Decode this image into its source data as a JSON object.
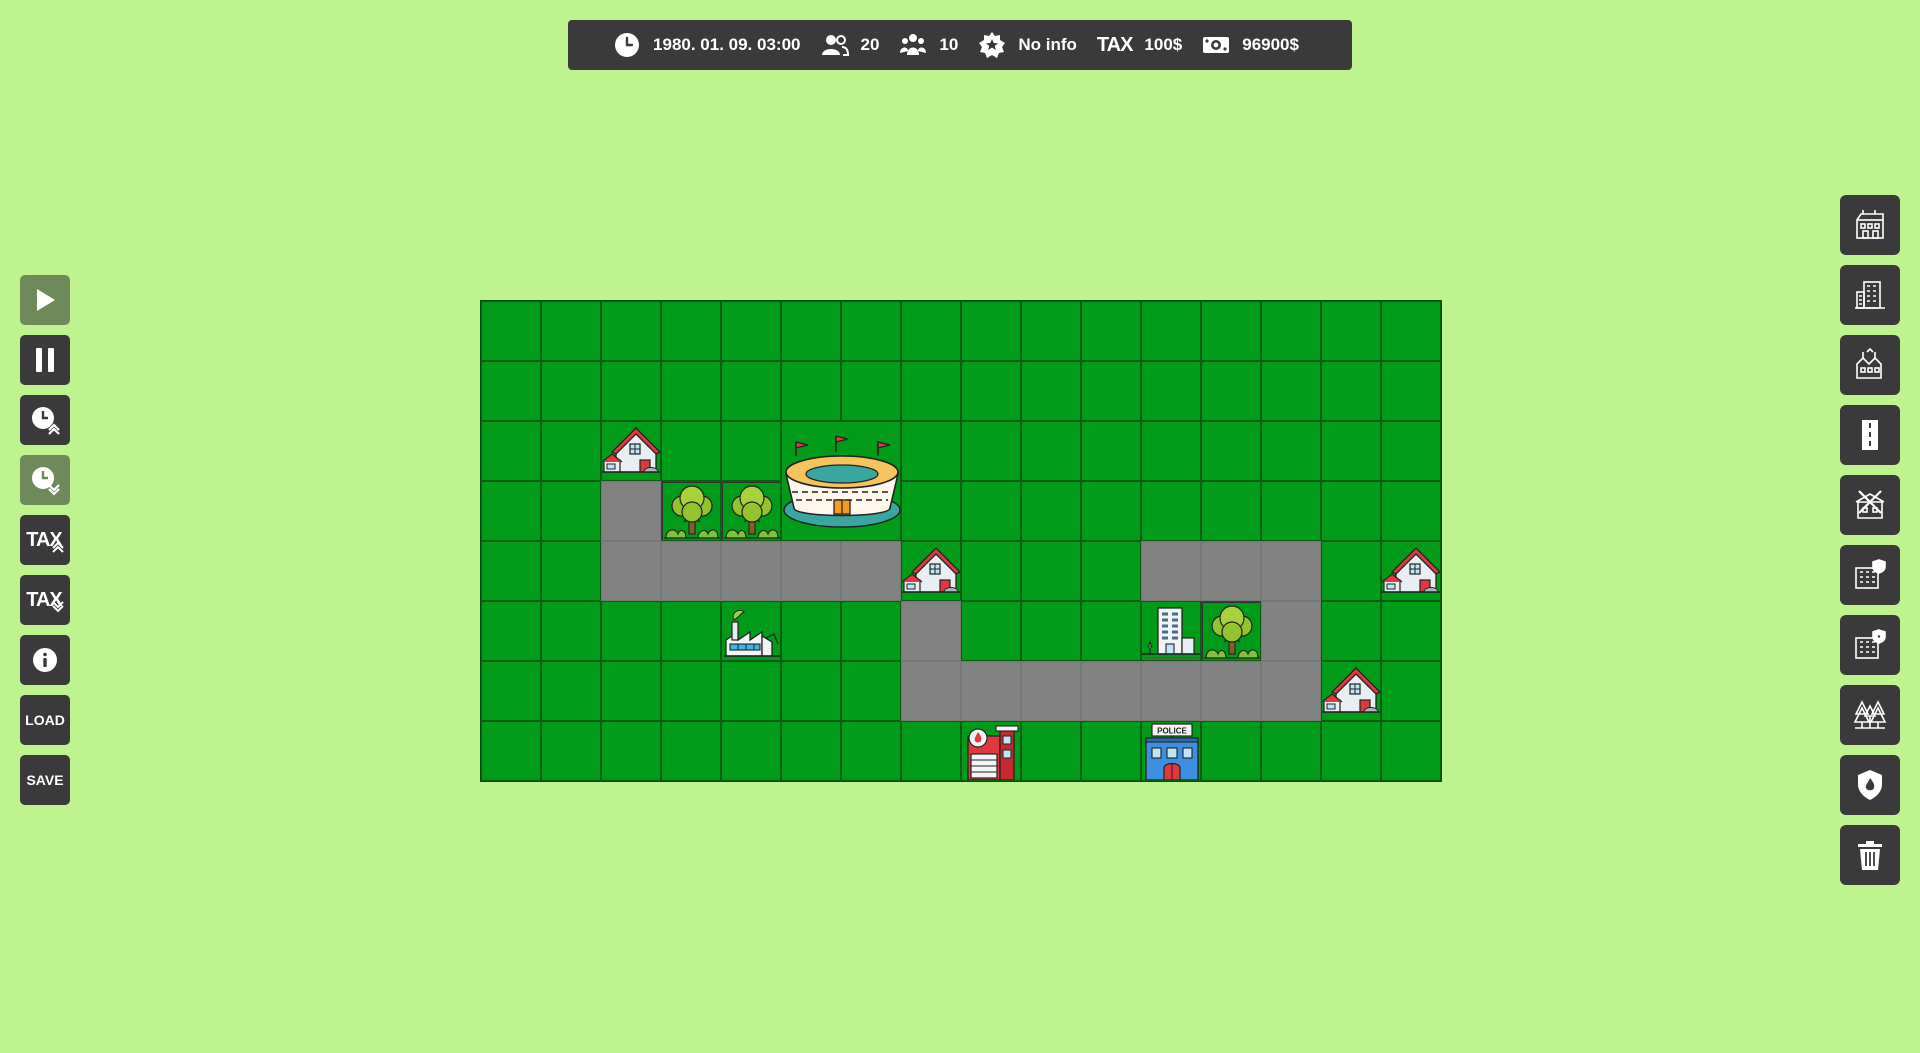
{
  "status_bar": {
    "date_time": "1980. 01. 09. 03:00",
    "population": "20",
    "workers": "10",
    "satisfaction": "No info",
    "tax_label": "TAX",
    "tax_value": "100$",
    "money": "96900$",
    "icons": [
      "clock-icon",
      "people-icon",
      "workers-icon",
      "star-badge-icon",
      "tax-icon",
      "money-icon"
    ]
  },
  "left_controls": {
    "play": {
      "icon": "play-icon",
      "state": "inactive"
    },
    "pause": {
      "icon": "pause-icon",
      "state": "active"
    },
    "speed_up": {
      "icon": "clock-speed-up-icon"
    },
    "speed_down": {
      "icon": "clock-speed-down-icon",
      "state": "inactive"
    },
    "tax_up_label": "TAX",
    "tax_down_label": "TAX",
    "info": {
      "icon": "info-icon"
    },
    "load_label": "LOAD",
    "save_label": "SAVE"
  },
  "right_toolbar": {
    "tools": [
      "residential-zone-icon",
      "office-building-icon",
      "industrial-zone-icon",
      "road-icon",
      "demolish-zone-icon",
      "police-station-icon",
      "fire-station-icon",
      "forest-icon",
      "fire-safety-icon",
      "trash-icon"
    ]
  },
  "map": {
    "cols": 16,
    "rows": 8,
    "colors": {
      "grass": "#009c19",
      "road": "#828282",
      "background": "#bff390",
      "bar": "#3a3a3a"
    },
    "legend": {
      ".": "grass",
      "R": "road",
      "H": "house",
      "T": "tree",
      "F": "factory",
      "O": "office",
      "X": "fire-station",
      "P": "police-station",
      "S": "stadium"
    },
    "tiles": [
      "................",
      "................",
      "..H..S..........",
      "..RTT...........",
      "..RRRRRH...RRR.H.",
      "....F..R...OTR..",
      ".......RRRRRRRH.",
      "........X..P...."
    ],
    "police_sign": "POLICE"
  }
}
